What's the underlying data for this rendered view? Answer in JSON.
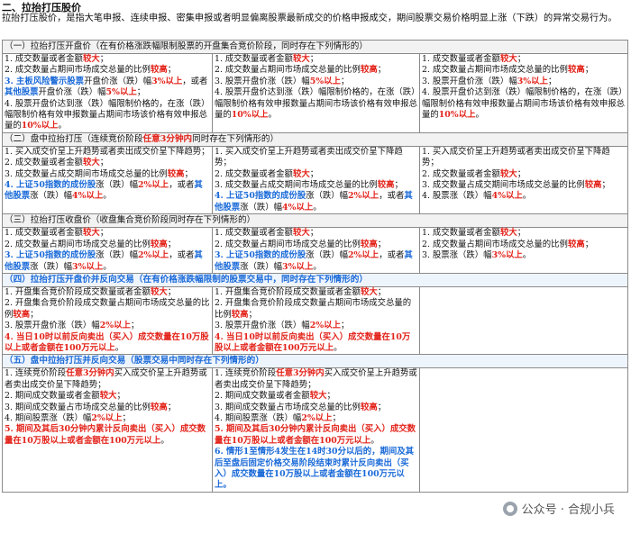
{
  "heading": "二、拉抬打压股价",
  "intro": "拉抬打压股价，是指大笔申报、连续申报、密集申报或者明显偏离股票最新成交的价格申报成交，期间股票交易价格明显上涨（下跌）的异常交易行为。",
  "sections": [
    {
      "title": "（一）拉抬打压开盘价（在有价格涨跌幅限制股票的开盘集合竞价阶段，同时存在下列情形的）",
      "style": "plain",
      "cells": [
        [
          [
            {
              "t": "1. 成交数量或者金额"
            },
            {
              "t": "较大",
              "c": "red"
            },
            {
              "t": "；"
            }
          ],
          [
            {
              "t": "2. 成交数量占期间市场成交总量的比例"
            },
            {
              "t": "较高",
              "c": "red"
            },
            {
              "t": "；"
            }
          ],
          [
            {
              "t": "3. 主板风险警示股票",
              "c": "blue"
            },
            {
              "t": "开盘价涨（跌）幅"
            },
            {
              "t": "3%以上",
              "c": "red"
            },
            {
              "t": "，或者"
            }
          ],
          [
            {
              "t": "其他股票",
              "c": "blue"
            },
            {
              "t": "开盘价涨（跌）幅"
            },
            {
              "t": "5%以上",
              "c": "red"
            },
            {
              "t": "；"
            }
          ],
          [
            {
              "t": "4. 股票开盘价达到涨（跌）幅限制价格的，在涨（跌）幅限制价格有效申报数量占期间市场该价格有效申报总量的"
            },
            {
              "t": "10%以上",
              "c": "red"
            },
            {
              "t": "。"
            }
          ]
        ],
        [
          [
            {
              "t": "1. 成交数量或者金额"
            },
            {
              "t": "较大",
              "c": "red"
            },
            {
              "t": "；"
            }
          ],
          [
            {
              "t": "2. 成交数量占期间市场成交总量的比例"
            },
            {
              "t": "较高",
              "c": "red"
            },
            {
              "t": "；"
            }
          ],
          [
            {
              "t": "3. 股票开盘价涨（跌）幅"
            },
            {
              "t": "5%以上",
              "c": "red"
            },
            {
              "t": "；"
            }
          ],
          [
            {
              "t": "4. 股票开盘价达到涨（跌）幅限制价格的，在涨（跌）幅限制价格有效申报数量占期间市场该价格有效申报总量的"
            },
            {
              "t": "10%以上",
              "c": "red"
            },
            {
              "t": "。"
            }
          ]
        ],
        [
          [
            {
              "t": "1. 成交数量或者金额"
            },
            {
              "t": "较大",
              "c": "red"
            },
            {
              "t": "；"
            }
          ],
          [
            {
              "t": "2. 成交数量占期间市场成交总量的比例"
            },
            {
              "t": "较高",
              "c": "red"
            },
            {
              "t": "；"
            }
          ],
          [
            {
              "t": "3. 股票开盘价涨（跌）幅"
            },
            {
              "t": "3%以上",
              "c": "red"
            },
            {
              "t": "；"
            }
          ],
          [
            {
              "t": "4. 股票开盘价达到涨（跌）幅限制价格的，在涨（跌）幅限制价格有效申报数量占期间市场该价格有效申报总量的"
            },
            {
              "t": "10%以上",
              "c": "red"
            },
            {
              "t": "。"
            }
          ]
        ]
      ]
    },
    {
      "title": "（二）盘中拉抬打压（连续竞价阶段任意3分钟内同时存在下列情形的）",
      "title_parts": [
        {
          "t": "（二）盘中拉抬打压（连续竞价阶段"
        },
        {
          "t": "任意3分钟内",
          "c": "red"
        },
        {
          "t": "同时存在下列情形的）"
        }
      ],
      "style": "plain",
      "cells": [
        [
          [
            {
              "t": "1. 买入成交价呈上升趋势或者卖出成交价呈下降趋势；"
            }
          ],
          [
            {
              "t": "2. 成交数量或者金额"
            },
            {
              "t": "较大",
              "c": "red"
            },
            {
              "t": "；"
            }
          ],
          [
            {
              "t": "3. 成交数量占成交期间市场成交总量的比例"
            },
            {
              "t": "较高",
              "c": "red"
            },
            {
              "t": "；"
            }
          ],
          [
            {
              "t": "4. 上证50指数的成份股",
              "c": "blue"
            },
            {
              "t": "涨（跌）幅"
            },
            {
              "t": "2%以上",
              "c": "red"
            },
            {
              "t": "，或者"
            },
            {
              "t": "其他股票",
              "c": "blue"
            },
            {
              "t": "涨（跌）幅"
            },
            {
              "t": "4%以上",
              "c": "red"
            },
            {
              "t": "。"
            }
          ]
        ],
        [
          [
            {
              "t": "1. 买入成交价呈上升趋势或者卖出成交价呈下降趋势；"
            }
          ],
          [
            {
              "t": "2. 成交数量或者金额"
            },
            {
              "t": "较大",
              "c": "red"
            },
            {
              "t": "；"
            }
          ],
          [
            {
              "t": "3. 成交数量占成交期间市场成交总量的比例"
            },
            {
              "t": "较高",
              "c": "red"
            },
            {
              "t": "；"
            }
          ],
          [
            {
              "t": "4. 上证50指数的成份股",
              "c": "blue"
            },
            {
              "t": "涨（跌）幅"
            },
            {
              "t": "2%以上",
              "c": "red"
            },
            {
              "t": "，或者"
            },
            {
              "t": "其他股票",
              "c": "blue"
            },
            {
              "t": "涨（跌）幅"
            },
            {
              "t": "4%以上",
              "c": "red"
            },
            {
              "t": "。"
            }
          ]
        ],
        [
          [
            {
              "t": "1. 买入成交价呈上升趋势或者卖出成交价呈下降趋势；"
            }
          ],
          [
            {
              "t": "2. 成交数量或者金额"
            },
            {
              "t": "较大",
              "c": "red"
            },
            {
              "t": "；"
            }
          ],
          [
            {
              "t": "3. 成交数量占成交期间市场成交总量的比例"
            },
            {
              "t": "较高",
              "c": "red"
            },
            {
              "t": "；"
            }
          ],
          [
            {
              "t": "4. 股票涨（跌）幅"
            },
            {
              "t": "4%以上",
              "c": "red"
            },
            {
              "t": "。"
            }
          ]
        ]
      ]
    },
    {
      "title": "（三）拉抬打压收盘价（收盘集合竞价阶段同时存在下列情形的）",
      "style": "plain",
      "cells": [
        [
          [
            {
              "t": "1. 成交数量或者金额"
            },
            {
              "t": "较大",
              "c": "red"
            },
            {
              "t": "；"
            }
          ],
          [
            {
              "t": "2. 成交数量占期间市场成交总量的比例"
            },
            {
              "t": "较高",
              "c": "red"
            },
            {
              "t": "；"
            }
          ],
          [
            {
              "t": "3. 上证50指数的成份股",
              "c": "blue"
            },
            {
              "t": "涨（跌）幅"
            },
            {
              "t": "2%以上",
              "c": "red"
            },
            {
              "t": "，或者"
            },
            {
              "t": "其他股票",
              "c": "blue"
            },
            {
              "t": "涨（跌）幅"
            },
            {
              "t": "3%以上",
              "c": "red"
            },
            {
              "t": "。"
            }
          ]
        ],
        [
          [
            {
              "t": "1. 成交数量或者金额"
            },
            {
              "t": "较大",
              "c": "red"
            },
            {
              "t": "；"
            }
          ],
          [
            {
              "t": "2. 成交数量占期间市场成交总量的比例"
            },
            {
              "t": "较高",
              "c": "red"
            },
            {
              "t": "；"
            }
          ],
          [
            {
              "t": "3. 上证50指数的成份股",
              "c": "blue"
            },
            {
              "t": "涨（跌）幅"
            },
            {
              "t": "2%以上",
              "c": "red"
            },
            {
              "t": "，或者"
            },
            {
              "t": "其他股票",
              "c": "blue"
            },
            {
              "t": "涨（跌）幅"
            },
            {
              "t": "3%以上",
              "c": "red"
            },
            {
              "t": "。"
            }
          ]
        ],
        [
          [
            {
              "t": "1. 成交数量或者金额"
            },
            {
              "t": "较大",
              "c": "red"
            },
            {
              "t": "；"
            }
          ],
          [
            {
              "t": "2. 成交数量占期间市场成交总量的比例"
            },
            {
              "t": "较高",
              "c": "red"
            },
            {
              "t": "；"
            }
          ],
          [
            {
              "t": "3. 股票涨（跌）幅"
            },
            {
              "t": "3%以上",
              "c": "red"
            },
            {
              "t": "。"
            }
          ]
        ]
      ]
    },
    {
      "title": "（四）拉抬打压开盘价并反向交易（在有价格涨跌幅限制的股票交易中，同时存在下列情形的）",
      "style": "blue",
      "cells": [
        [
          [
            {
              "t": "1. 开盘集合竞价阶段成交数量或者金额"
            },
            {
              "t": "较大",
              "c": "red"
            },
            {
              "t": "；"
            }
          ],
          [
            {
              "t": "2. 开盘集合竞价阶段成交数量占期间市场成交总量的比例"
            },
            {
              "t": "较高",
              "c": "red"
            },
            {
              "t": "；"
            }
          ],
          [
            {
              "t": "3. 股票开盘价涨（跌）幅"
            },
            {
              "t": "2%以上",
              "c": "red"
            },
            {
              "t": "；"
            }
          ],
          [
            {
              "t": "4. 当日10时以前反向卖出（买入）成交数量在10万股以上或者金额在100万元以上",
              "c": "red"
            },
            {
              "t": "。"
            }
          ]
        ],
        [
          [
            {
              "t": "1. 开盘集合竞价阶段成交数量或者金额"
            },
            {
              "t": "较大",
              "c": "red"
            },
            {
              "t": "；"
            }
          ],
          [
            {
              "t": "2. 开盘集合竞价阶段成交数量占期间市场成交总量的比例"
            },
            {
              "t": "较高",
              "c": "red"
            },
            {
              "t": "；"
            }
          ],
          [
            {
              "t": "3. 股票开盘价涨（跌）幅"
            },
            {
              "t": "2%以上",
              "c": "red"
            },
            {
              "t": "；"
            }
          ],
          [
            {
              "t": "4. 当日10时以前反向卖出（买入）成交数量在10万股以上或者金额在100万元以上",
              "c": "red"
            },
            {
              "t": "。"
            }
          ]
        ],
        []
      ]
    },
    {
      "title": "（五）盘中拉抬打压并反向交易（股票交易中同时存在下列情形的）",
      "style": "blue",
      "cells": [
        [
          [
            {
              "t": "1. 连续竞价阶段"
            },
            {
              "t": "任意3分钟内",
              "c": "red"
            },
            {
              "t": "买入成交价呈上升趋势或者卖出成交价呈下降趋势；"
            }
          ],
          [
            {
              "t": "2. 期间成交数量或者金额"
            },
            {
              "t": "较大",
              "c": "red"
            },
            {
              "t": "；"
            }
          ],
          [
            {
              "t": "3. 期间成交数量占市场成交总量的比例"
            },
            {
              "t": "较高",
              "c": "red"
            },
            {
              "t": "；"
            }
          ],
          [
            {
              "t": "4. 期间股票涨（跌）幅"
            },
            {
              "t": "2%以上",
              "c": "red"
            },
            {
              "t": "；"
            }
          ],
          [
            {
              "t": "5. 期间及其后30分钟内",
              "c": "red"
            },
            {
              "t": "累计反向卖出（买入）成交数量在10万股以上或者金额在100万元以上",
              "c": "red"
            },
            {
              "t": "。"
            }
          ]
        ],
        [
          [
            {
              "t": "1. 连续竞价阶段"
            },
            {
              "t": "任意3分钟内",
              "c": "red"
            },
            {
              "t": "买入成交价呈上升趋势或者卖出成交价呈下降趋势；"
            }
          ],
          [
            {
              "t": "2. 期间成交数量或者金额"
            },
            {
              "t": "较大",
              "c": "red"
            },
            {
              "t": "；"
            }
          ],
          [
            {
              "t": "3. 期间成交数量占市场成交总量的比例"
            },
            {
              "t": "较高",
              "c": "red"
            },
            {
              "t": "；"
            }
          ],
          [
            {
              "t": "4. 期间股票涨（跌）幅"
            },
            {
              "t": "2%以上",
              "c": "red"
            },
            {
              "t": "；"
            }
          ],
          [
            {
              "t": "5. 期间及其后30分钟内",
              "c": "red"
            },
            {
              "t": "累计反向卖出（买入）成交数量在10万股以上或者金额在100万元以上",
              "c": "red"
            },
            {
              "t": "。"
            }
          ],
          [
            {
              "t": "6. 情形1至情形4发生在14时30分以后的，期间及其后至盘后固定价格交易阶段结束时累计反向卖出（买入）成交数量在10万股以上或者金额在100万元以上。",
              "c": "blue"
            }
          ]
        ],
        []
      ]
    }
  ],
  "watermark": "公众号 · 合规小兵"
}
